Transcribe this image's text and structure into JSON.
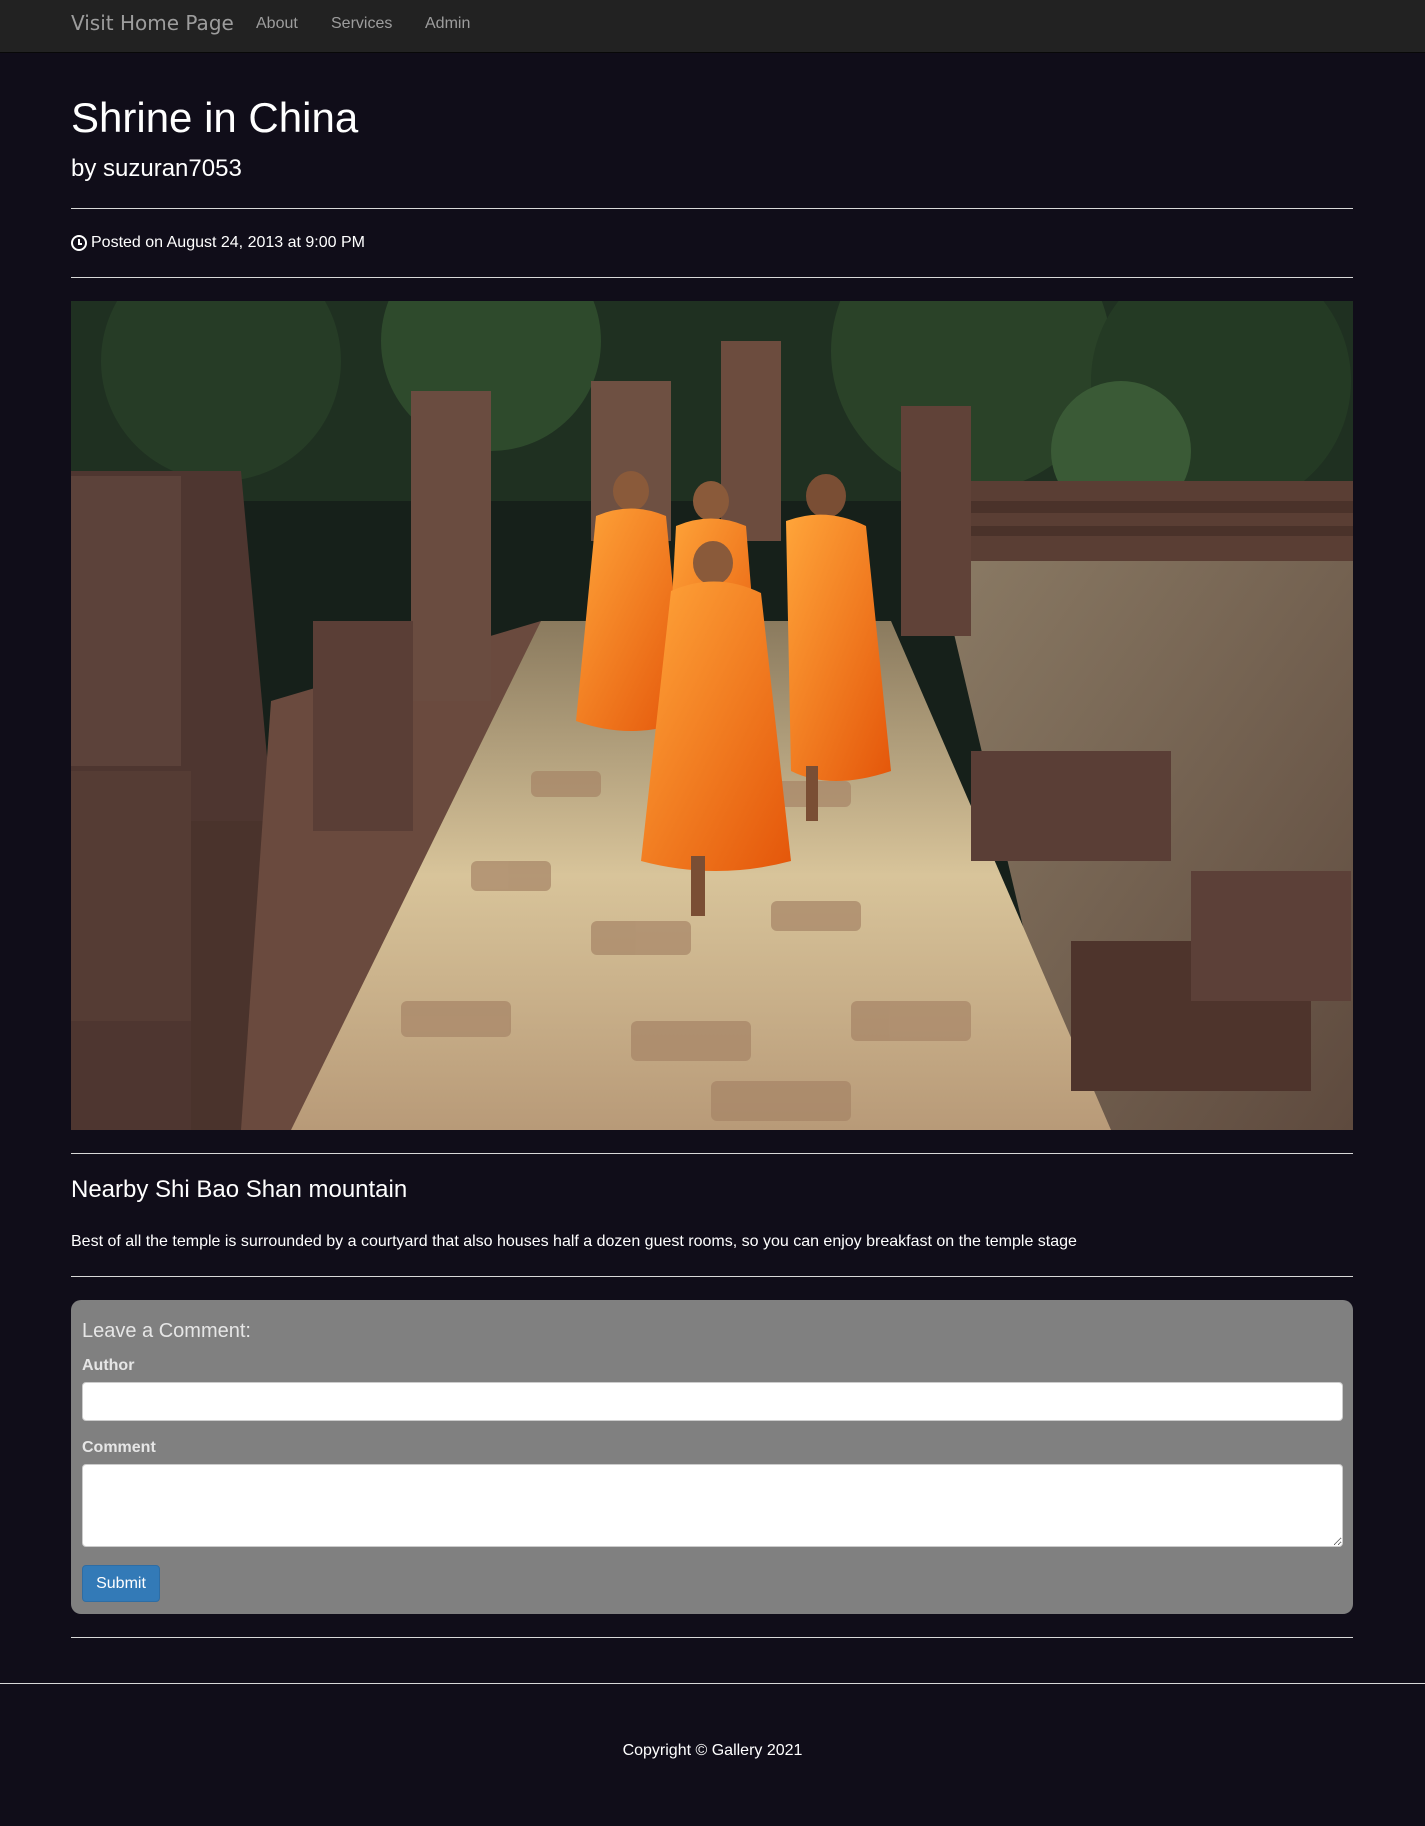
{
  "navbar": {
    "brand": "Visit Home Page",
    "links": [
      "About",
      "Services",
      "Admin"
    ]
  },
  "post": {
    "title": "Shrine in China",
    "author": "by suzuran7053",
    "posted": "Posted on August 24, 2013 at 9:00 PM",
    "image_alt": "Monks in orange robes walking along a stone temple path",
    "subtitle": "Nearby Shi Bao Shan mountain",
    "description": "Best of all the temple is surrounded by a courtyard that also houses half a dozen guest rooms, so you can enjoy breakfast on the temple stage"
  },
  "comment_form": {
    "heading": "Leave a Comment:",
    "author_label": "Author",
    "author_value": "",
    "comment_label": "Comment",
    "comment_value": "",
    "submit_label": "Submit"
  },
  "footer": {
    "copyright": "Copyright © Gallery 2021"
  },
  "colors": {
    "page_bg": "#100d19",
    "navbar_bg": "#222222",
    "well_bg": "#808080",
    "button": "#337ab7"
  },
  "icons": {
    "posted": "clock-icon"
  }
}
